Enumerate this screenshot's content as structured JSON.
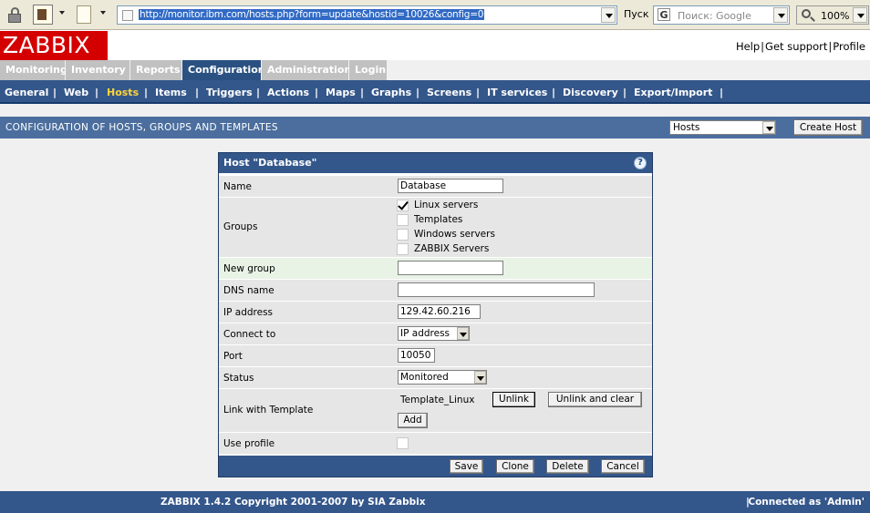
{
  "browser": {
    "url": "http://monitor.ibm.com/hosts.php?form=update&hostid=10026&config=0",
    "go_label": "Пуск",
    "search_placeholder": "Поиск: Google",
    "search_engine_glyph": "G",
    "zoom": "100%"
  },
  "header": {
    "logo": "ZABBIX",
    "links": [
      "Help",
      "Get support",
      "Profile"
    ],
    "link_separator": "|"
  },
  "main_menu": [
    {
      "label": "Monitoring",
      "active": false
    },
    {
      "label": "Inventory",
      "active": false
    },
    {
      "label": "Reports",
      "active": false
    },
    {
      "label": "Configuration",
      "active": true
    },
    {
      "label": "Administration",
      "active": false
    },
    {
      "label": "Login",
      "active": false
    }
  ],
  "sub_menu": {
    "separator": "|",
    "items": [
      {
        "label": "General",
        "active": false
      },
      {
        "label": "Web",
        "active": false
      },
      {
        "label": "Hosts",
        "active": true
      },
      {
        "label": "Items",
        "active": false
      },
      {
        "label": "Triggers",
        "active": false
      },
      {
        "label": "Actions",
        "active": false
      },
      {
        "label": "Maps",
        "active": false
      },
      {
        "label": "Graphs",
        "active": false
      },
      {
        "label": "Screens",
        "active": false
      },
      {
        "label": "IT services",
        "active": false
      },
      {
        "label": "Discovery",
        "active": false
      },
      {
        "label": "Export/Import",
        "active": false
      }
    ]
  },
  "page_title": {
    "text": "CONFIGURATION OF HOSTS, GROUPS AND TEMPLATES",
    "view_select": "Hosts",
    "create_button": "Create Host"
  },
  "form": {
    "title": "Host \"Database\"",
    "help_glyph": "?",
    "labels": {
      "name": "Name",
      "groups": "Groups",
      "new_group": "New group",
      "dns": "DNS name",
      "ip": "IP address",
      "connect": "Connect to",
      "port": "Port",
      "status": "Status",
      "link_template": "Link with Template",
      "use_profile": "Use profile"
    },
    "values": {
      "name": "Database",
      "new_group": "",
      "dns": "",
      "ip": "129.42.60.216",
      "connect": "IP address",
      "port": "10050",
      "status": "Monitored",
      "use_profile": false
    },
    "groups": [
      {
        "label": "Linux servers",
        "checked": true
      },
      {
        "label": "Templates",
        "checked": false
      },
      {
        "label": "Windows servers",
        "checked": false
      },
      {
        "label": "ZABBIX Servers",
        "checked": false
      }
    ],
    "template": {
      "name": "Template_Linux",
      "unlink": "Unlink",
      "unlink_clear": "Unlink and clear",
      "add": "Add"
    },
    "buttons": {
      "save": "Save",
      "clone": "Clone",
      "delete": "Delete",
      "cancel": "Cancel"
    }
  },
  "footer": {
    "copyright": "ZABBIX 1.4.2 Copyright 2001-2007 by  SIA Zabbix",
    "separator": "|",
    "connected": "Connected as 'Admin'"
  },
  "colors": {
    "brand_red": "#d40000",
    "nav_blue": "#34578b",
    "active_submenu": "#ffd43a"
  }
}
